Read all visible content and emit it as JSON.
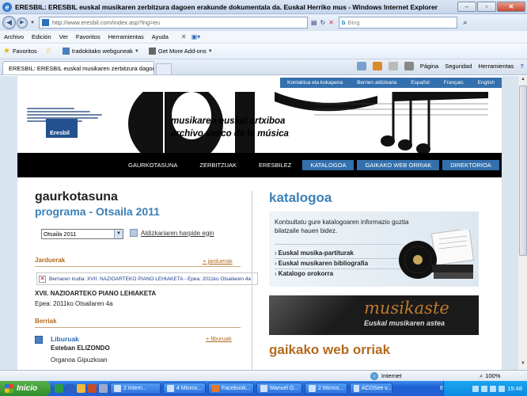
{
  "window": {
    "title": "ERESBIL: ERESBIL euskal musikaren zerbitzura dagoen erakunde dokumentala da. Euskal Herriko mus - Windows Internet Explorer"
  },
  "address": {
    "url": "http://www.eresbil.com/index.asp?lng=eu",
    "search_placeholder": "Bing"
  },
  "menu": [
    "Archivo",
    "Edición",
    "Ver",
    "Favoritos",
    "Herramientas",
    "Ayuda"
  ],
  "favorites": {
    "label": "Favoritos",
    "items": [
      "Iradokitako webguneak",
      "Get More Add-ons"
    ]
  },
  "tab": {
    "label": "ERESBIL: ERESBIL euskal musikaren zerbitzura dagoe..."
  },
  "commandbar": {
    "page": "Página",
    "security": "Seguridad",
    "tools": "Herramientas",
    "help": "?"
  },
  "site": {
    "topnav": [
      "Kontaktua eta kokapena",
      "Berrien aldizkaria",
      "Español",
      "Français",
      "English"
    ],
    "banner": {
      "logo": "Eresbil",
      "title1": "musikaren euskal artxiboa",
      "title2": "archivo vasco de la música"
    },
    "mainnav": [
      "GAURKOTASUNA",
      "ZERBITZUAK",
      "ERESBILEZ"
    ],
    "mainnav_blue": [
      "KATALOGOA",
      "GAIKAKO WEB ORRIAK",
      "DIREKTORIOA"
    ],
    "left": {
      "heading": "gaurkotasuna",
      "subheading": "programa - Otsaila 2011",
      "select_value": "Otsaila 2011",
      "subscribe": "Aldizkariaren harpide egin",
      "jarduerak": "Jarduerak",
      "jarduerak_link": "+ jarduerak",
      "broken_image": "Berriaren irudia: XVII. NAZIOARTEKO PIANO LEHIAKETA    - Epea: 2011ko Otsailaren 4a",
      "news_title": "XVII. NAZIOARTEKO PIANO LEHIAKETA",
      "news_date": "Epea: 2011ko Otsailaren 4a",
      "berriak": "Berriak",
      "liburuak": "Liburuak",
      "liburuak_link": "+ liburuak",
      "author": "Esteban ELIZONDO",
      "org": "Organoa Gipuzkoan"
    },
    "right": {
      "heading": "katalogoa",
      "desc": "Kontsultatu gure katalogoaren informazio guztia bilatzaile hauen bidez.",
      "links": [
        "Euskal musika-partiturak",
        "Euskal musikaren bibliografia",
        "Katalogo orokorra"
      ],
      "musikaste_title": "musikaste",
      "musikaste_sub": "Euskal musikaren astea",
      "gaikako": "gaikako web orriak"
    }
  },
  "status": {
    "zone": "Internet",
    "zoom": "100%"
  },
  "taskbar": {
    "start": "Inicio",
    "tasks": [
      "2 Intern...",
      "4 Micros...",
      "Facebook...",
      "Manuel G...",
      "2 Micros...",
      "ACDSee v..."
    ],
    "lang": "EU",
    "clock": "15:48"
  }
}
